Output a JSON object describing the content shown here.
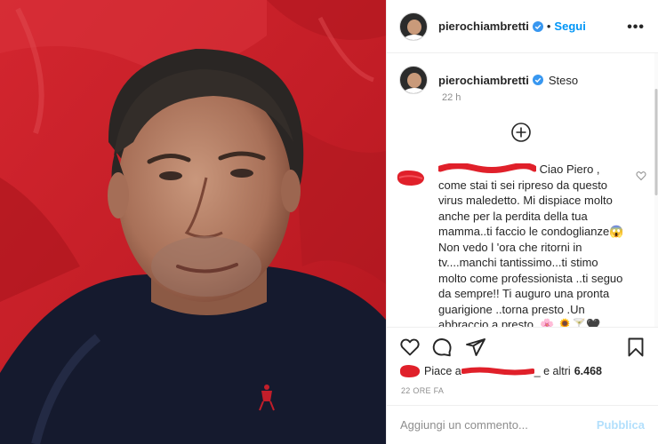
{
  "header": {
    "username": "pierochiambretti",
    "separator": "•",
    "follow_label": "Segui",
    "more_label": "•••"
  },
  "caption": {
    "username": "pierochiambretti",
    "text": "Steso",
    "time": "22 h"
  },
  "comment": {
    "text": "Ciao Piero , come stai ti sei ripreso da questo virus maledetto. Mi dispiace molto anche per la perdita della tua mamma..ti faccio le condoglianze😱 Non vedo l 'ora che ritorni in tv....manchi tantissimo...ti stimo molto come professionista ..ti seguo da sempre!! Ti auguro una pronta guarigione ..torna presto .Un abbraccio a presto. 🌸 🌻🍸🖤 Michela Tori"
  },
  "likes": {
    "prefix": "Piace a",
    "suffix": "_ e altri",
    "count": "6.468"
  },
  "time_ago": "22 ORE FA",
  "comment_input": {
    "placeholder": "Aggiungi un commento...",
    "publish_label": "Pubblica"
  },
  "colors": {
    "accent": "#0095f6",
    "publish_disabled": "#b2dffc",
    "redaction": "#e0202a",
    "secondary_text": "#8e8e8e"
  }
}
